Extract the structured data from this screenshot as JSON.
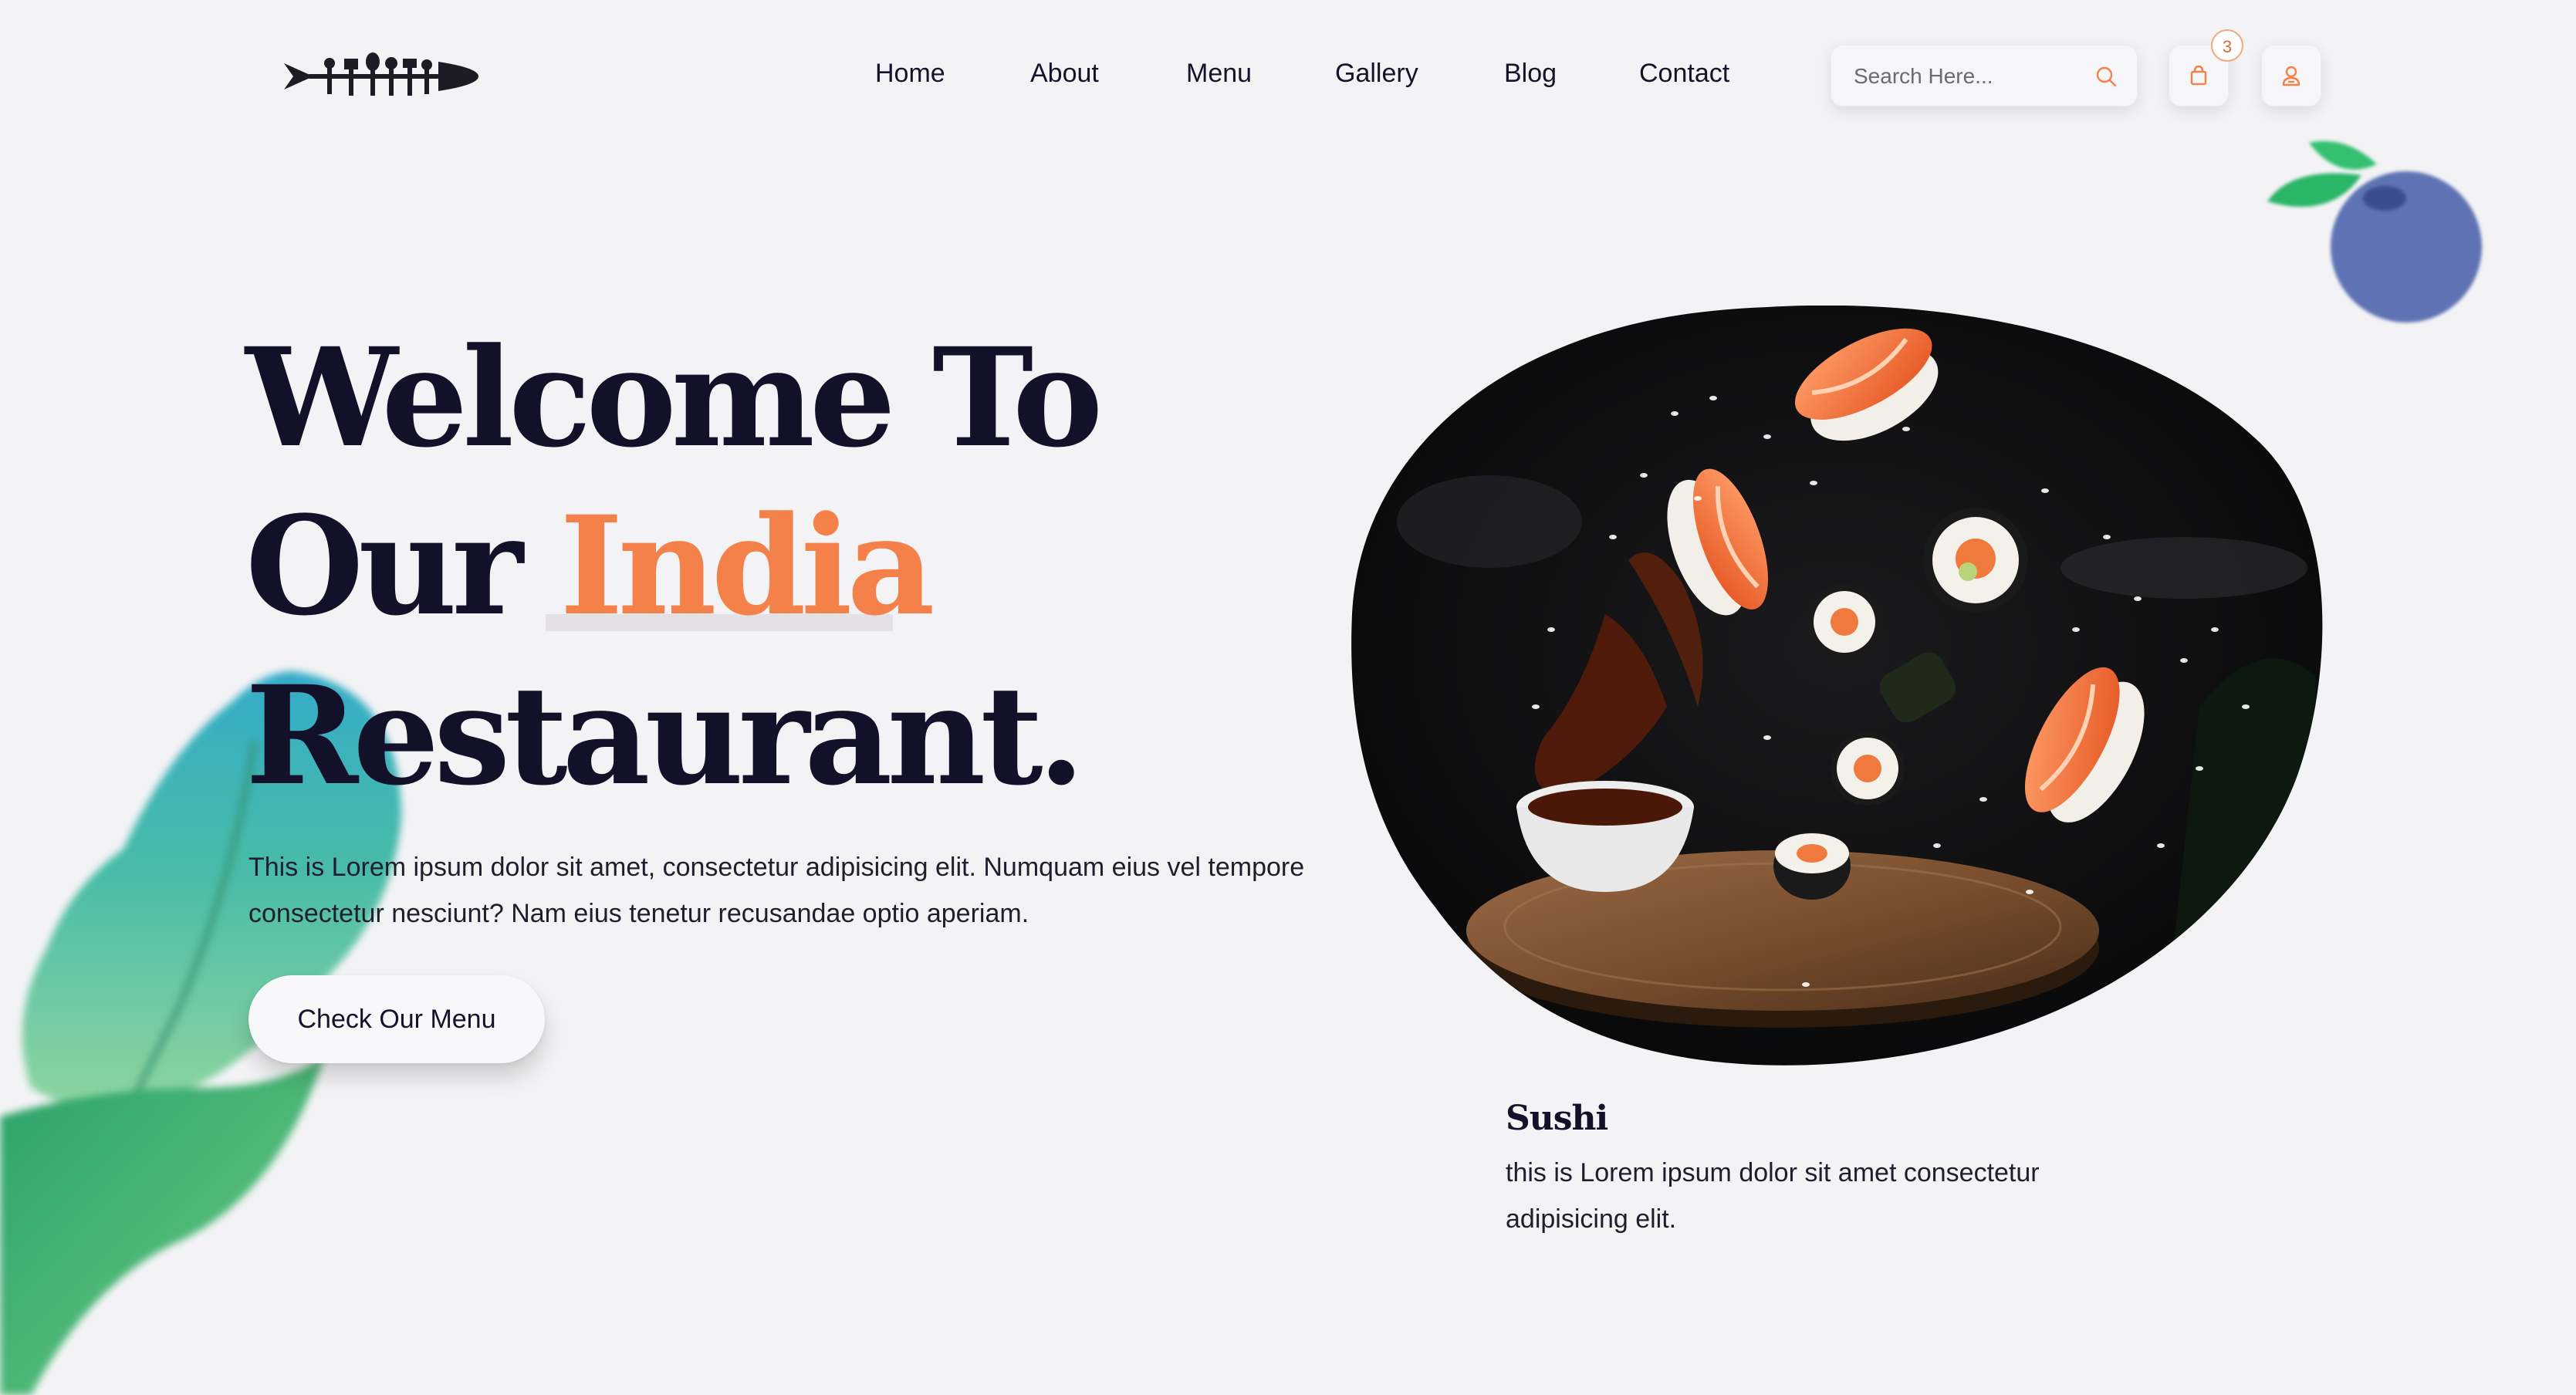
{
  "nav": {
    "links": [
      "Home",
      "About",
      "Menu",
      "Gallery",
      "Blog",
      "Contact"
    ]
  },
  "search": {
    "placeholder": "Search Here..."
  },
  "cart": {
    "count": "3"
  },
  "hero": {
    "line1": "Welcome To",
    "line2_prefix": "Our ",
    "line2_highlight": "India",
    "line3": "Restaurant.",
    "description": "This is Lorem ipsum dolor sit amet, consectetur adipisicing elit. Numquam eius vel tempore consectetur nesciunt? Nam eius tenetur recusandae optio aperiam.",
    "button_label": "Check Our Menu"
  },
  "featured": {
    "name": "Sushi",
    "description": "this is Lorem ipsum dolor sit amet consectetur adipisicing elit."
  },
  "colors": {
    "accent": "#f5814a",
    "heading": "#13112a",
    "background": "#f3f3f5"
  },
  "icons": [
    "logo",
    "search-icon",
    "bag-icon",
    "user-icon",
    "berry-decoration",
    "leaf-decoration"
  ]
}
